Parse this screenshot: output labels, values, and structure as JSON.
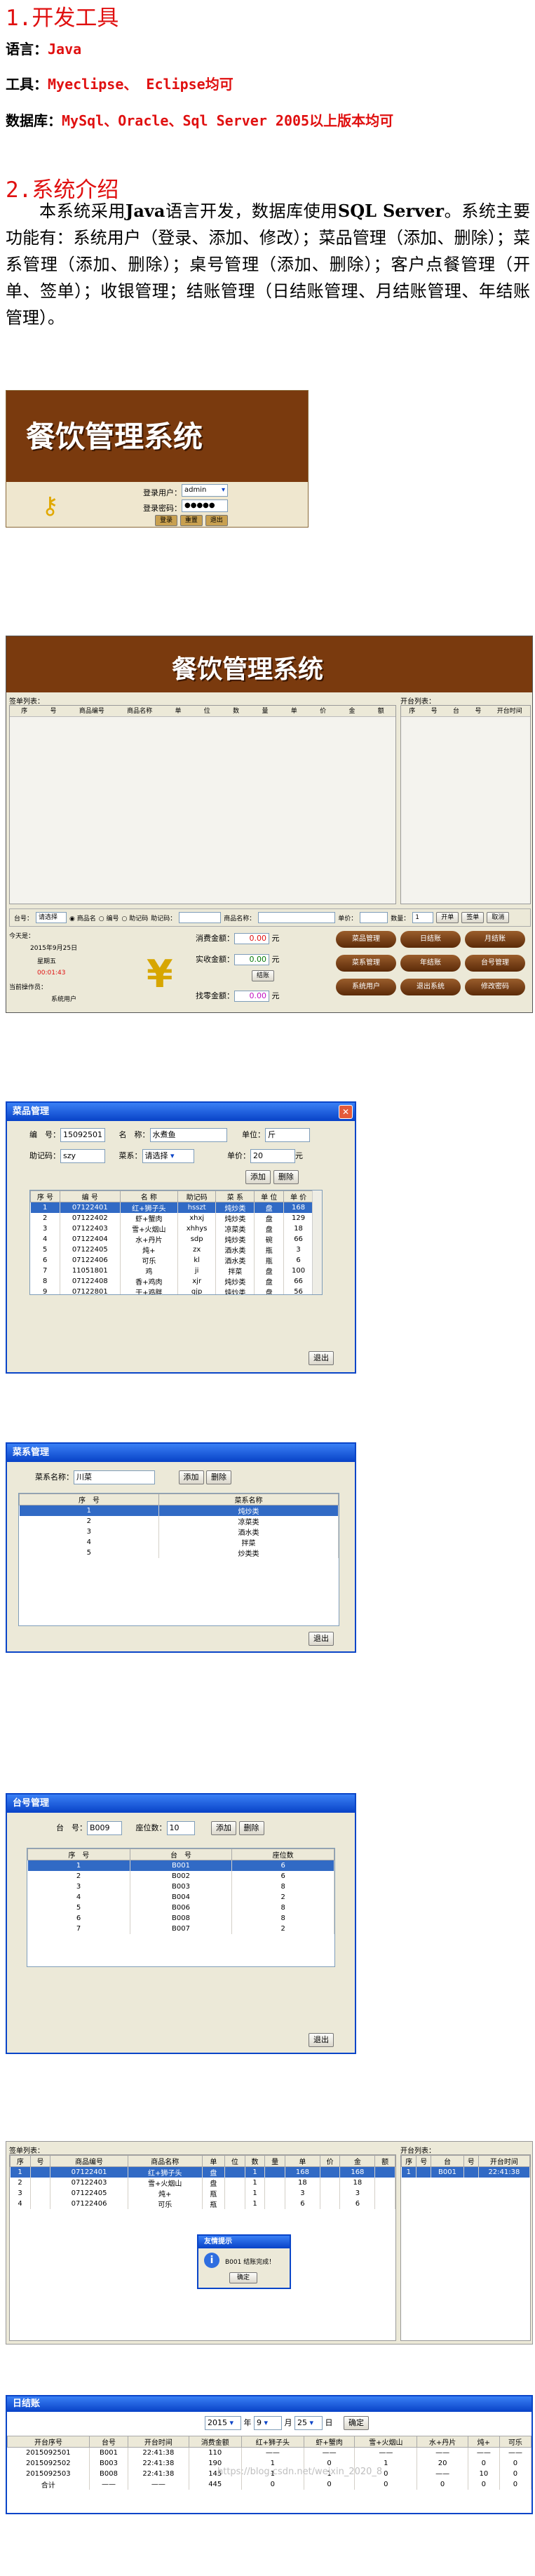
{
  "section1": {
    "title": "1.开发工具",
    "lines": [
      {
        "key": "语言：",
        "val": "Java"
      },
      {
        "key": "工具：",
        "val": "Myeclipse、 Eclipse均可"
      },
      {
        "key": "数据库：",
        "val": "MySql、Oracle、Sql Server 2005以上版本均可"
      }
    ]
  },
  "section2": {
    "title": "2.系统介绍",
    "intro": {
      "p1": "本系统采用",
      "b1": "Java",
      "p2": "语言开发，数据库使用",
      "b2": "SQL Server",
      "p3": "。系统主要功能有：系统用户（登录、添加、修改）；菜品管理（添加、删除）；菜系管理（添加、删除）；桌号管理（添加、删除）；客户点餐管理（开单、签单）；收银管理；结账管理（日结账管理、月结账管理、年结账管理）。"
    }
  },
  "login": {
    "logo": "餐饮管理系统",
    "user_label": "登录用户：",
    "user_value": "admin",
    "pass_label": "登录密码：",
    "pass_value": "●●●●●",
    "buttons": [
      "登录",
      "重置",
      "退出"
    ]
  },
  "main": {
    "logo": "餐饮管理系统",
    "order_list_title": "签单列表：",
    "open_list_title": "开台列表：",
    "order_cols": [
      "序",
      "号",
      "商品编号",
      "商品名称",
      "单",
      "位",
      "数",
      "量",
      "单",
      "价",
      "金",
      "额"
    ],
    "open_cols": [
      "序",
      "号",
      "台",
      "号",
      "开台时间"
    ],
    "bar": {
      "table_label": "台号：",
      "table_select": "请选择",
      "radio1": "商品名",
      "radio2": "编号",
      "radio3": "助记码",
      "code_label": "助记码：",
      "name_label": "商品名称：",
      "price_label": "单价：",
      "qty_label": "数量：",
      "qty_value": "1",
      "buttons": [
        "开单",
        "签单",
        "取消"
      ]
    },
    "today": {
      "label": "今天是：",
      "date": "2015年9月25日",
      "weekday": "星期五",
      "time": "00:01:43",
      "operator_label": "当前操作员：",
      "operator": "系统用户"
    },
    "money": {
      "consume_label": "消费金额：",
      "consume_value": "0.00",
      "consume_unit": "元",
      "paid_label": "实收金额：",
      "paid_value": "0.00",
      "paid_unit": "元",
      "settle_btn": "结账",
      "change_label": "找零金额：",
      "change_value": "0.00",
      "change_unit": "元"
    },
    "actions": [
      "菜品管理",
      "日结账",
      "月结账",
      "菜系管理",
      "年结账",
      "台号管理",
      "系统用户",
      "退出系统",
      "修改密码"
    ]
  },
  "dish": {
    "title": "菜品管理",
    "no_label": "编　号：",
    "no_value": "15092501",
    "name_label": "名　称：",
    "name_value": "水煮鱼",
    "unit_label": "单位：",
    "unit_value": "斤",
    "code_label": "助记码：",
    "code_value": "szy",
    "type_label": "菜系：",
    "type_value": "请选择",
    "price_label": "单价：",
    "price_value": "20",
    "price_unit": "元",
    "add": "添加",
    "del": "删除",
    "cols": [
      "序 号",
      "编 号",
      "名 称",
      "助记码",
      "菜 系",
      "单 位",
      "单 价"
    ],
    "rows": [
      [
        "1",
        "07122401",
        "红+狮子头",
        "hsszt",
        "炖炒类",
        "盘",
        "168"
      ],
      [
        "2",
        "07122402",
        "虾+蟹肉",
        "xhxj",
        "炖炒类",
        "盘",
        "129"
      ],
      [
        "3",
        "07122403",
        "雪+火烟山",
        "xhhys",
        "凉菜类",
        "盘",
        "18"
      ],
      [
        "4",
        "07122404",
        "水+丹片",
        "sdp",
        "炖炒类",
        "碗",
        "66"
      ],
      [
        "5",
        "07122405",
        "炖+",
        "zx",
        "酒水类",
        "瓶",
        "3"
      ],
      [
        "6",
        "07122406",
        "可乐",
        "kl",
        "酒水类",
        "瓶",
        "6"
      ],
      [
        "7",
        "11051801",
        "鸡",
        "ji",
        "拌菜",
        "盘",
        "100"
      ],
      [
        "8",
        "07122408",
        "香+鸡肉",
        "xjr",
        "炖炒类",
        "盘",
        "66"
      ],
      [
        "9",
        "07122801",
        "干+鸡胖",
        "gjp",
        "炖炒类",
        "盘",
        "56"
      ]
    ],
    "exit": "退出"
  },
  "cuisine": {
    "title": "菜系管理",
    "name_label": "菜系名称：",
    "name_value": "川菜",
    "add": "添加",
    "del": "删除",
    "cols": [
      "序　号",
      "菜系名称"
    ],
    "rows": [
      [
        "1",
        "炖炒类"
      ],
      [
        "2",
        "凉菜类"
      ],
      [
        "3",
        "酒水类"
      ],
      [
        "4",
        "拌菜"
      ],
      [
        "5",
        "炒类类"
      ]
    ],
    "exit": "退出"
  },
  "tableNo": {
    "title": "台号管理",
    "no_label": "台　号：",
    "no_value": "B009",
    "seats_label": "座位数：",
    "seats_value": "10",
    "add": "添加",
    "del": "删除",
    "cols": [
      "序　号",
      "台　号",
      "座位数"
    ],
    "rows": [
      [
        "1",
        "B001",
        "6"
      ],
      [
        "2",
        "B002",
        "6"
      ],
      [
        "3",
        "B003",
        "8"
      ],
      [
        "4",
        "B004",
        "2"
      ],
      [
        "5",
        "B006",
        "8"
      ],
      [
        "6",
        "B008",
        "8"
      ],
      [
        "7",
        "B007",
        "2"
      ]
    ],
    "exit": "退出"
  },
  "cashier": {
    "order_title": "签单列表：",
    "open_title": "开台列表：",
    "cols": [
      "序",
      "号",
      "商品编号",
      "商品名称",
      "单",
      "位",
      "数",
      "量",
      "单",
      "价",
      "金",
      "额"
    ],
    "rows": [
      [
        "1",
        "",
        "07122401",
        "红+狮子头",
        "盘",
        "",
        "1",
        "",
        "168",
        "",
        "168",
        ""
      ],
      [
        "2",
        "",
        "07122403",
        "雪+火烟山",
        "盘",
        "",
        "1",
        "",
        "18",
        "",
        "18",
        ""
      ],
      [
        "3",
        "",
        "07122405",
        "炖+",
        "瓶",
        "",
        "1",
        "",
        "3",
        "",
        "3",
        ""
      ],
      [
        "4",
        "",
        "07122406",
        "可乐",
        "瓶",
        "",
        "1",
        "",
        "6",
        "",
        "6",
        ""
      ]
    ],
    "open_cols": [
      "序",
      "号",
      "台",
      "号",
      "开台时间"
    ],
    "open_rows": [
      [
        "1",
        "",
        "B001",
        "",
        "22:41:38"
      ]
    ],
    "dialog_title": "友情提示",
    "dialog_msg": "B001 结账完成！",
    "dialog_btn": "确定"
  },
  "daily": {
    "title": "日结账",
    "year": "2015",
    "year_unit": "年",
    "month": "9",
    "month_unit": "月",
    "day": "25",
    "day_unit": "日",
    "ok": "确定",
    "cols": [
      "开台序号",
      "台号",
      "开台时间",
      "消费金额",
      "红+狮子头",
      "虾+蟹肉",
      "雪+火烟山",
      "水+丹片",
      "炖+",
      "可乐"
    ],
    "rows": [
      [
        "2015092501",
        "B001",
        "22:41:38",
        "110",
        "——",
        "——",
        "——",
        "——",
        "——",
        "——"
      ],
      [
        "2015092502",
        "B003",
        "22:41:38",
        "190",
        "1",
        "0",
        "1",
        "20",
        "0",
        "0"
      ],
      [
        "2015092503",
        "B008",
        "22:41:38",
        "145",
        "1",
        "1",
        "0",
        "——",
        "10",
        "0"
      ],
      [
        "合计",
        "——",
        "——",
        "445",
        "0",
        "0",
        "0",
        "0",
        "0",
        "0"
      ]
    ],
    "watermark": "https://blog.csdn.net/weixin_2020_8"
  }
}
